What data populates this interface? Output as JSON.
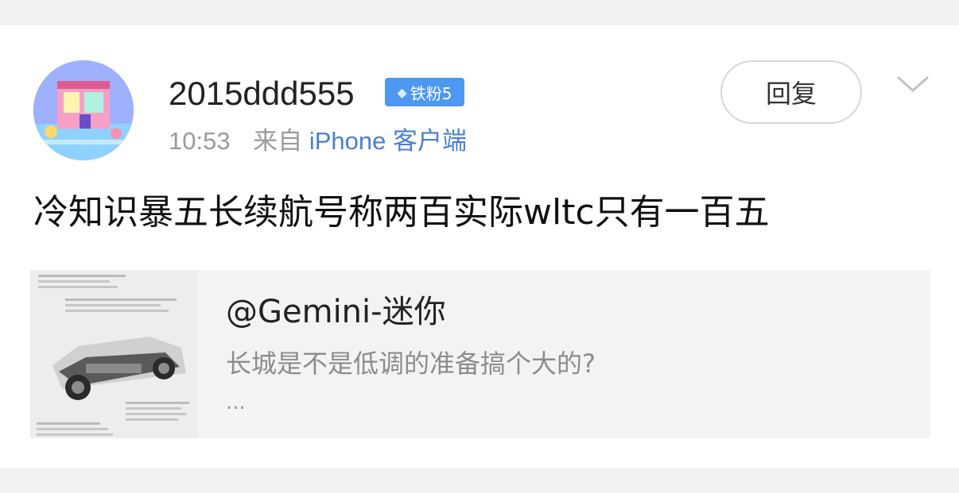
{
  "post": {
    "username": "2015ddd555",
    "badge": "铁粉5",
    "time": "10:53",
    "source_prefix": "来自",
    "source_client": "iPhone 客户端",
    "content": "冷知识暴五长续航号称两百实际wltc只有一百五",
    "reply_label": "回复"
  },
  "repost": {
    "user": "@Gemini-迷你",
    "text": "长城是不是低调的准备搞个大的?",
    "ellipsis": "..."
  },
  "icons": {
    "badge": "diamond-icon",
    "menu": "chevron-down-icon"
  },
  "colors": {
    "badge_bg": "#4d98f0",
    "client_link": "#4a7fd0",
    "repost_bg": "#f3f3f3"
  }
}
